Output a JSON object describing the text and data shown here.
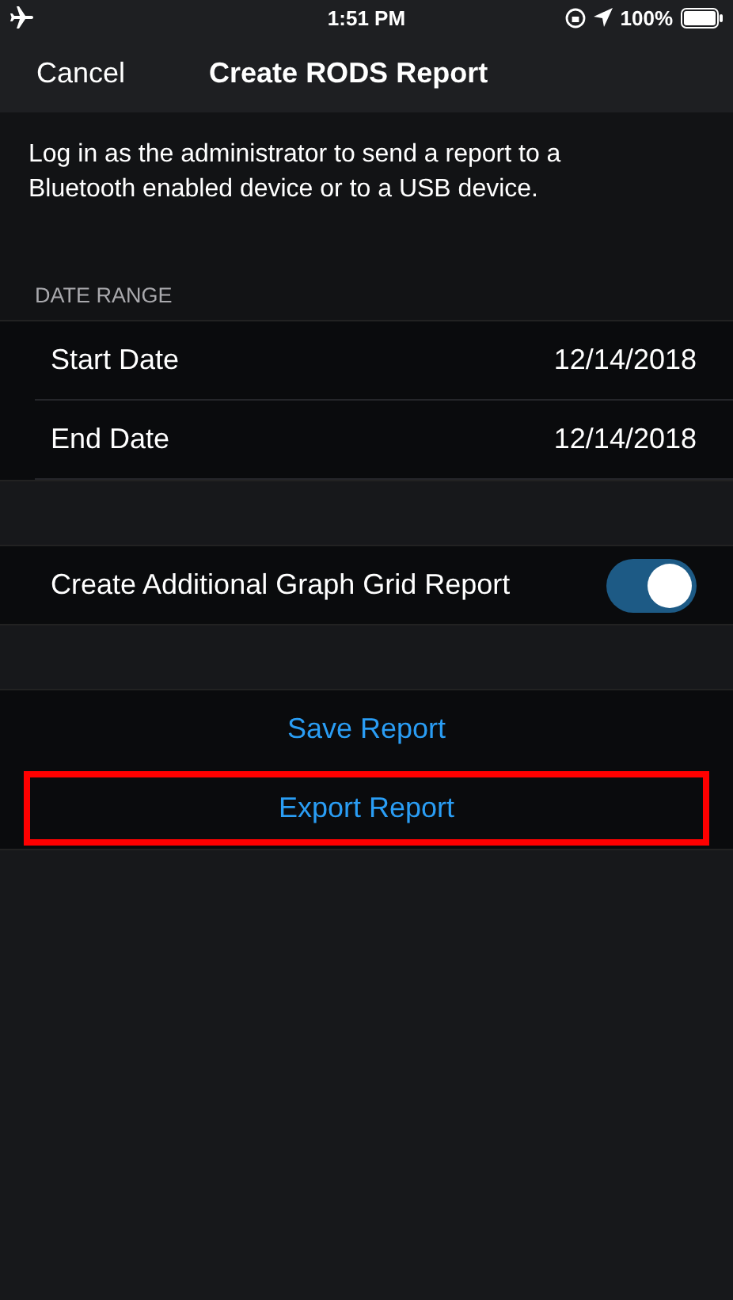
{
  "status_bar": {
    "time": "1:51 PM",
    "battery": "100%"
  },
  "nav": {
    "cancel": "Cancel",
    "title": "Create RODS Report"
  },
  "description": "Log in as the administrator to send a report to a Bluetooth enabled device or to a USB device.",
  "date_range": {
    "header": "DATE RANGE",
    "rows": [
      {
        "label": "Start Date",
        "value": "12/14/2018"
      },
      {
        "label": "End Date",
        "value": "12/14/2018"
      }
    ]
  },
  "graph_option": {
    "label": "Create Additional Graph Grid Report",
    "on": true
  },
  "actions": [
    {
      "label": "Save Report",
      "highlighted": false
    },
    {
      "label": "Export Report",
      "highlighted": true
    }
  ]
}
